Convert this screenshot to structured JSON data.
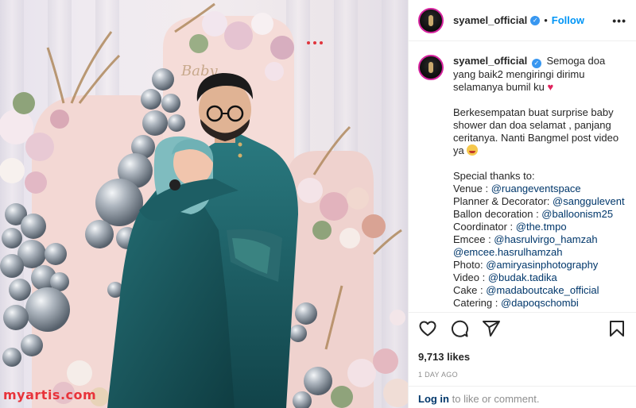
{
  "post": {
    "username": "syamel_official",
    "verified_glyph": "✓",
    "separator": "•",
    "follow_label": "Follow",
    "more_label": "•••"
  },
  "caption": {
    "username": "syamel_official",
    "line1": "Semoga doa yang baik2 mengiringi dirimu selamanya bumil ku",
    "heart": "♥",
    "para2": "Berkesempatan buat surprise baby shower dan doa selamat , panjang ceritanya. Nanti Bangmel post video ya",
    "thanks_title": "Special thanks to:",
    "credits": [
      {
        "label": "Venue : ",
        "handle": "@ruangeventspace"
      },
      {
        "label": "Planner & Decorator: ",
        "handle": "@sanggulevent"
      },
      {
        "label": "Ballon decoration : ",
        "handle": "@balloonism25"
      },
      {
        "label": "Coordinator : ",
        "handle": "@the.tmpo"
      },
      {
        "label": "Emcee : ",
        "handle": "@hasrulvirgo_hamzah"
      },
      {
        "label": "",
        "handle": "@emcee.hasrulhamzah"
      },
      {
        "label": "Photo: ",
        "handle": "@amiryasinphotography"
      },
      {
        "label": "Video : ",
        "handle": "@budak.tadika"
      },
      {
        "label": "Cake : ",
        "handle": "@madaboutcake_official"
      },
      {
        "label": "Catering : ",
        "handle": "@dapoqschombi"
      }
    ]
  },
  "actions": {
    "icons": [
      "heart-icon",
      "comment-icon",
      "share-icon",
      "bookmark-icon"
    ],
    "likes": "9,713 likes",
    "date": "1 DAY AGO"
  },
  "login": {
    "link": "Log in",
    "rest": " to like or comment."
  },
  "photo": {
    "watermark": "myartis.com",
    "balloon_sign": "Baby"
  },
  "colors": {
    "follow_blue": "#0095f6",
    "verified_blue": "#3897f0",
    "link_navy": "#00376b",
    "dress_teal": "#1f5f66",
    "watermark_red": "#e8333a"
  }
}
